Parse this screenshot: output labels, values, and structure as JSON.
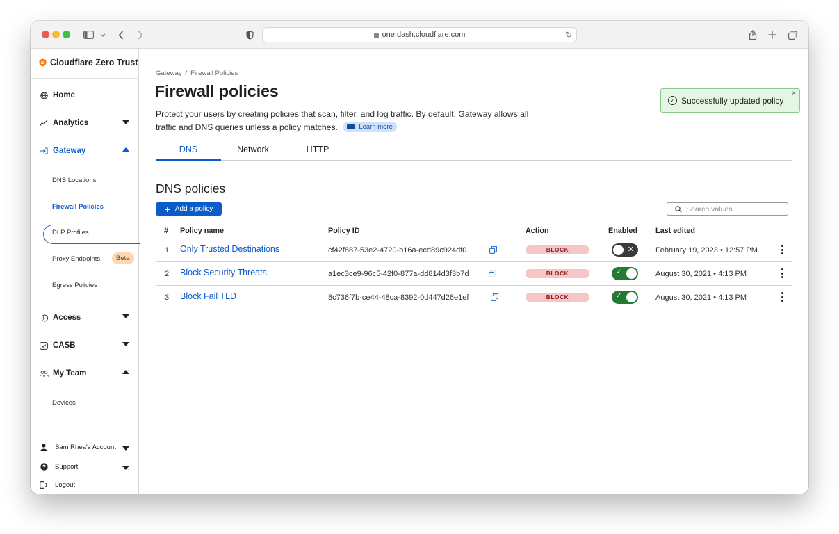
{
  "browser": {
    "url": "one.dash.cloudflare.com"
  },
  "sidebar": {
    "brand": "Cloudflare Zero Trust",
    "items": [
      {
        "label": "Home",
        "icon": "globe-icon"
      },
      {
        "label": "Analytics",
        "icon": "analytics-icon",
        "expanded": false
      },
      {
        "label": "Gateway",
        "icon": "gateway-icon",
        "expanded": true
      },
      {
        "label": "Access",
        "icon": "access-icon",
        "expanded": false
      },
      {
        "label": "CASB",
        "icon": "casb-icon",
        "expanded": false
      },
      {
        "label": "My Team",
        "icon": "team-icon",
        "expanded": true
      }
    ],
    "gateway_sub": [
      "DNS Locations",
      "Firewall Policies",
      "DLP Profiles",
      "Proxy Endpoints",
      "Egress Policies"
    ],
    "beta_badge": "Beta",
    "team_sub": [
      "Devices"
    ],
    "footer": [
      {
        "label": "Sam Rhea's Account",
        "icon": "user-icon"
      },
      {
        "label": "Support",
        "icon": "help-icon"
      },
      {
        "label": "Logout",
        "icon": "logout-icon"
      }
    ]
  },
  "main": {
    "breadcrumb": [
      "Gateway",
      "Firewall Policies"
    ],
    "breadcrumb_sep": "/",
    "title": "Firewall policies",
    "description": "Protect your users by creating policies that scan, filter, and log traffic. By default, Gateway allows all traffic and DNS queries unless a policy matches.",
    "learn_more": "Learn more",
    "tabs": [
      "DNS",
      "Network",
      "HTTP"
    ],
    "active_tab": "DNS",
    "section_title": "DNS policies",
    "add_button": "Add a policy",
    "search_placeholder": "Search values",
    "toast": "Successfully updated policy"
  },
  "table": {
    "columns": [
      "#",
      "Policy name",
      "Policy ID",
      "Action",
      "Enabled",
      "Last edited"
    ],
    "rows": [
      {
        "num": "1",
        "name": "Only Trusted Destinations",
        "id": "cf42f887-53e2-4720-b16a-ecd89c924df0",
        "action": "BLOCK",
        "enabled": false,
        "edited": "February 19, 2023 • 12:57 PM"
      },
      {
        "num": "2",
        "name": "Block Security Threats",
        "id": "a1ec3ce9-96c5-42f0-877a-dd814d3f3b7d",
        "action": "BLOCK",
        "enabled": true,
        "edited": "August 30, 2021 • 4:13 PM"
      },
      {
        "num": "3",
        "name": "Block Fail TLD",
        "id": "8c736f7b-ce44-48ca-8392-0d447d26e1ef",
        "action": "BLOCK",
        "enabled": true,
        "edited": "August 30, 2021 • 4:13 PM"
      }
    ]
  },
  "colors": {
    "accent": "#0b5cc9",
    "toggle_on": "#247a35",
    "toggle_off": "#3a3a3a",
    "block_badge": "#f6c6c6",
    "toast_bg": "#e4f5e3"
  }
}
